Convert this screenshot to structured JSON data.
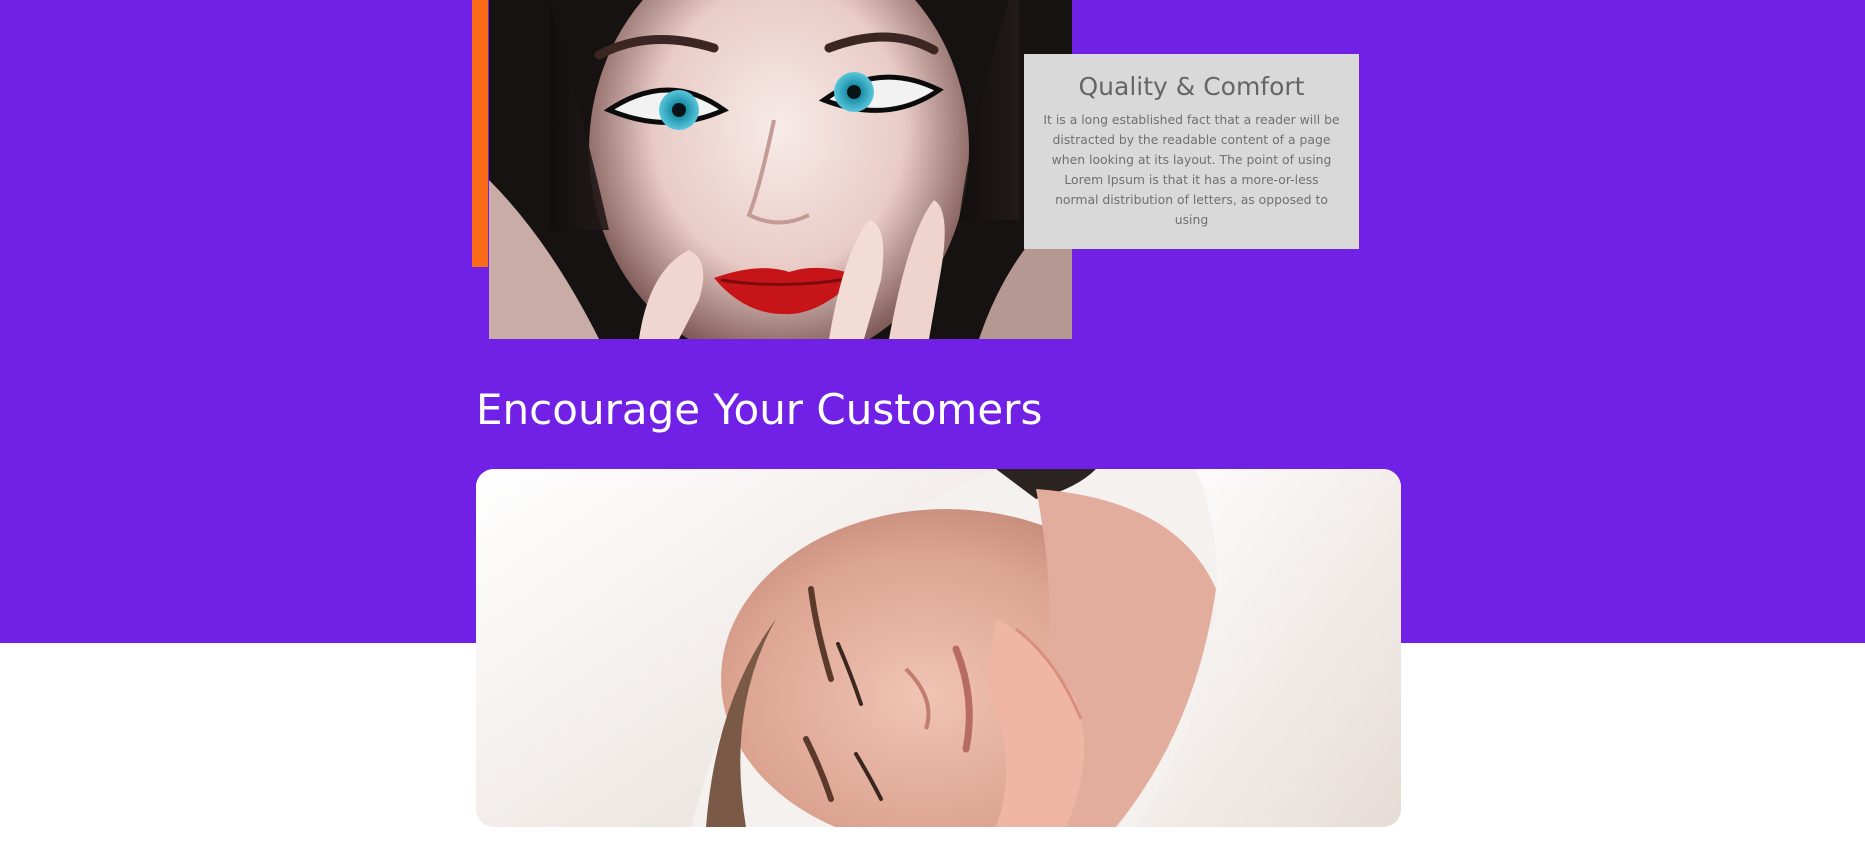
{
  "hero": {
    "background_color": "#7121e6",
    "accent_color": "#fb6a16",
    "portrait_image": {
      "alt": "close-up portrait of a woman with blue eyes and red lips"
    }
  },
  "quality_card": {
    "title": "Quality & Comfort",
    "body": "It is a long established fact that a reader will be distracted by the readable content of a page when looking at its layout. The point of using Lorem Ipsum is that it has a more-or-less normal distribution of letters, as opposed to using"
  },
  "section": {
    "heading": "Encourage Your Customers",
    "spa_image": {
      "alt": "woman with towel wrapped hair receiving a facial massage"
    }
  }
}
